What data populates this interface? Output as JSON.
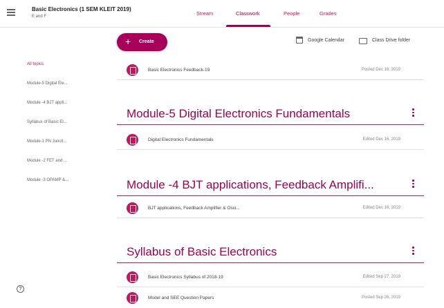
{
  "header": {
    "class_title": "Basic Electronics (1 SEM KLEIT 2019)",
    "class_subtitle": "E and F",
    "tabs": [
      {
        "label": "Stream"
      },
      {
        "label": "Classwork"
      },
      {
        "label": "People"
      },
      {
        "label": "Grades"
      }
    ],
    "active_tab": "Classwork"
  },
  "toolbar": {
    "create_label": "Create",
    "calendar_label": "Google Calendar",
    "drive_label": "Class Drive folder"
  },
  "sidebar": {
    "items": [
      {
        "label": "All topics"
      },
      {
        "label": "Module-5 Digital Ele..."
      },
      {
        "label": "Module -4 BJT appli..."
      },
      {
        "label": "Syllabus of Basic El..."
      },
      {
        "label": "Module-1 PN Juncti..."
      },
      {
        "label": "Module -2 FET and ..."
      },
      {
        "label": "Module -3 OPAMP &..."
      }
    ]
  },
  "stream": {
    "loose_item": {
      "title": "Basic Electronics Feedback-19",
      "date": "Posted Dec 16, 2019"
    },
    "topics": [
      {
        "title": "Module-5 Digital Electronics Fundamentals",
        "items": [
          {
            "title": "Digital Electronics Fundamentals",
            "date": "Edited Dec 16, 2019"
          }
        ]
      },
      {
        "title": "Module -4 BJT applications, Feedback Amplifi...",
        "items": [
          {
            "title": "BJT applications, Feedback Amplifier & Osci...",
            "date": "Edited Dec 16, 2019"
          }
        ]
      },
      {
        "title": "Syllabus of Basic Electronics",
        "items": [
          {
            "title": "Basic Electronics Syllabus of 2018-19",
            "date": "Edited Sep 27, 2019"
          },
          {
            "title": "Model and SEE Question Papers",
            "date": "Posted Sep 26, 2019"
          }
        ]
      }
    ]
  },
  "colors": {
    "accent": "#a0004d",
    "accent_light": "#c2185b",
    "create_button": "#a8005a"
  },
  "icons": {
    "menu": "hamburger-menu-icon",
    "calendar": "calendar-icon",
    "drive": "folder-icon",
    "help": "help-icon",
    "material": "assignment-icon",
    "topic_more": "more-vert-icon"
  }
}
